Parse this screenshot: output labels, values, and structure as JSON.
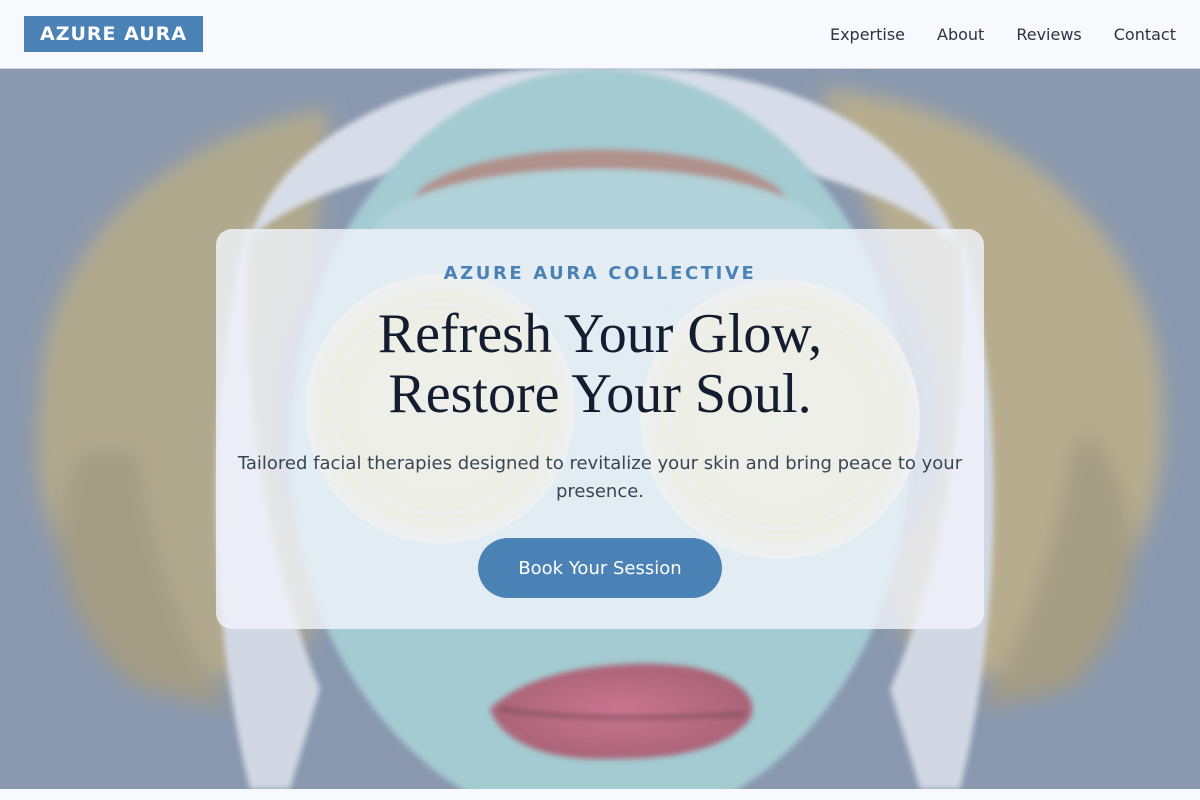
{
  "header": {
    "logo": "AZURE AURA",
    "nav": [
      {
        "label": "Expertise"
      },
      {
        "label": "About"
      },
      {
        "label": "Reviews"
      },
      {
        "label": "Contact"
      }
    ]
  },
  "hero": {
    "eyebrow": "AZURE AURA COLLECTIVE",
    "headline_line1": "Refresh Your Glow,",
    "headline_line2": "Restore Your Soul.",
    "subtext": "Tailored facial therapies designed to revitalize your skin and bring peace to your presence.",
    "cta_label": "Book Your Session",
    "image_subject": "woman with facial mask and lemon slices on eyes"
  },
  "colors": {
    "accent": "#4a82b5",
    "heading": "#141c30",
    "header_bg": "#f7f9fd"
  }
}
